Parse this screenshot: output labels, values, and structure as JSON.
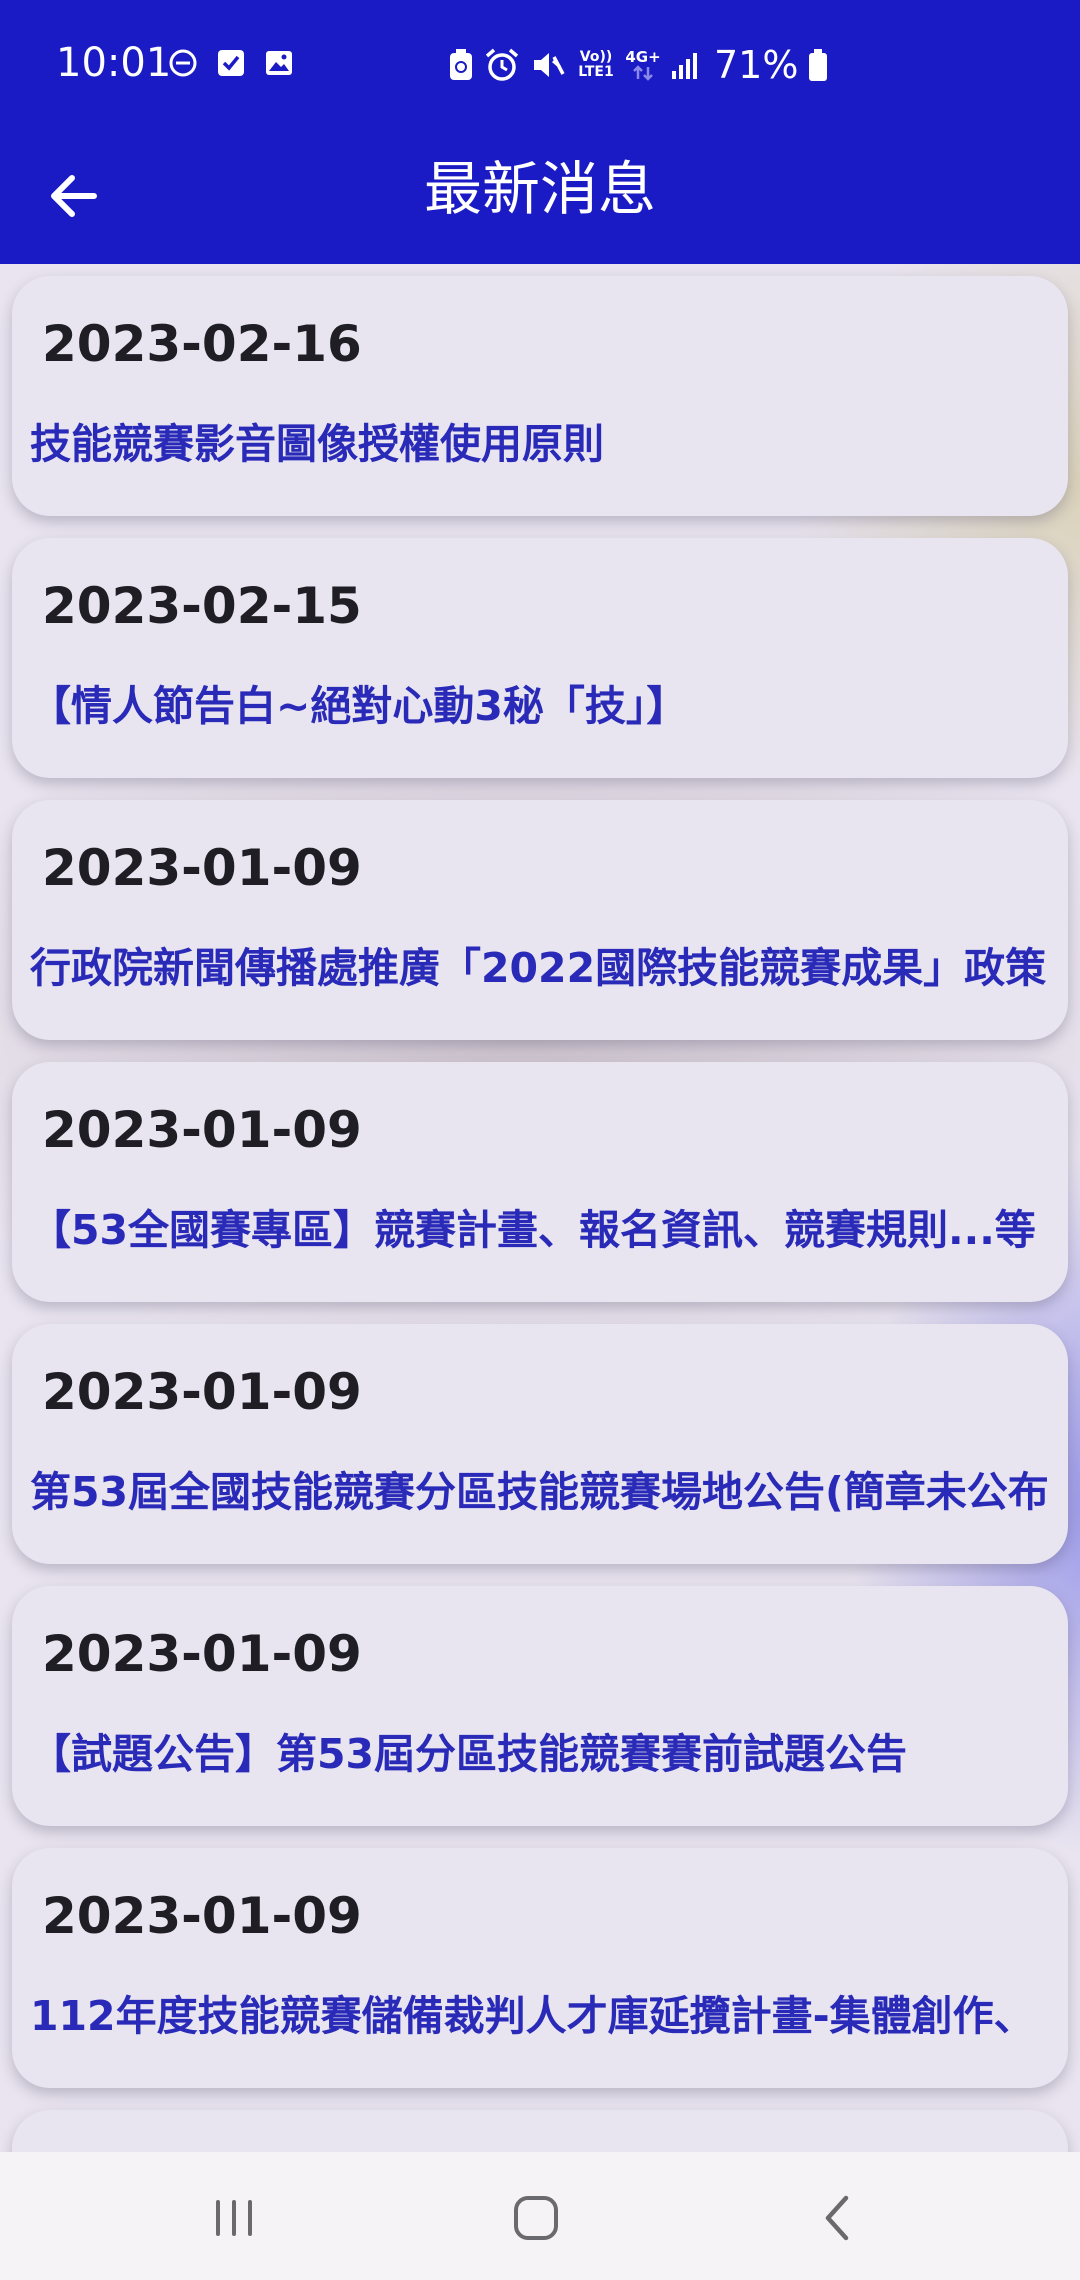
{
  "status_bar": {
    "time": "10:01",
    "network_label_top": "Vo))",
    "network_label_bottom": "LTE1",
    "network_type": "4G+",
    "battery": "71%",
    "icons": [
      "do-not-disturb-icon",
      "checkbox-icon",
      "image-icon",
      "battery-saver-icon",
      "alarm-icon",
      "mute-icon",
      "volte-icon",
      "data-arrows-icon",
      "signal-icon",
      "battery-icon"
    ]
  },
  "app_bar": {
    "title": "最新消息",
    "back_icon": "arrow-left-icon"
  },
  "news": [
    {
      "date": "2023-02-16",
      "title": "技能競賽影音圖像授權使用原則"
    },
    {
      "date": "2023-02-15",
      "title": "【情人節告白~絕對心動3秘「技」】"
    },
    {
      "date": "2023-01-09",
      "title": "行政院新聞傳播處推廣「2022國際技能競賽成果」政策"
    },
    {
      "date": "2023-01-09",
      "title": "【53全國賽專區】競賽計畫、報名資訊、競賽規則...等"
    },
    {
      "date": "2023-01-09",
      "title": "第53屆全國技能競賽分區技能競賽場地公告(簡章未公布"
    },
    {
      "date": "2023-01-09",
      "title": "【試題公告】第53屆分區技能競賽賽前試題公告"
    },
    {
      "date": "2023-01-09",
      "title": "112年度技能競賽儲備裁判人才庫延攬計畫-集體創作、"
    }
  ],
  "nav_bar": {
    "icons": [
      "recent-apps-icon",
      "home-icon",
      "back-icon"
    ]
  },
  "colors": {
    "primary": "#1a1bc4",
    "card": "#e8e4f0",
    "link_text": "#2a2ab8",
    "date_text": "#1e1e24"
  }
}
